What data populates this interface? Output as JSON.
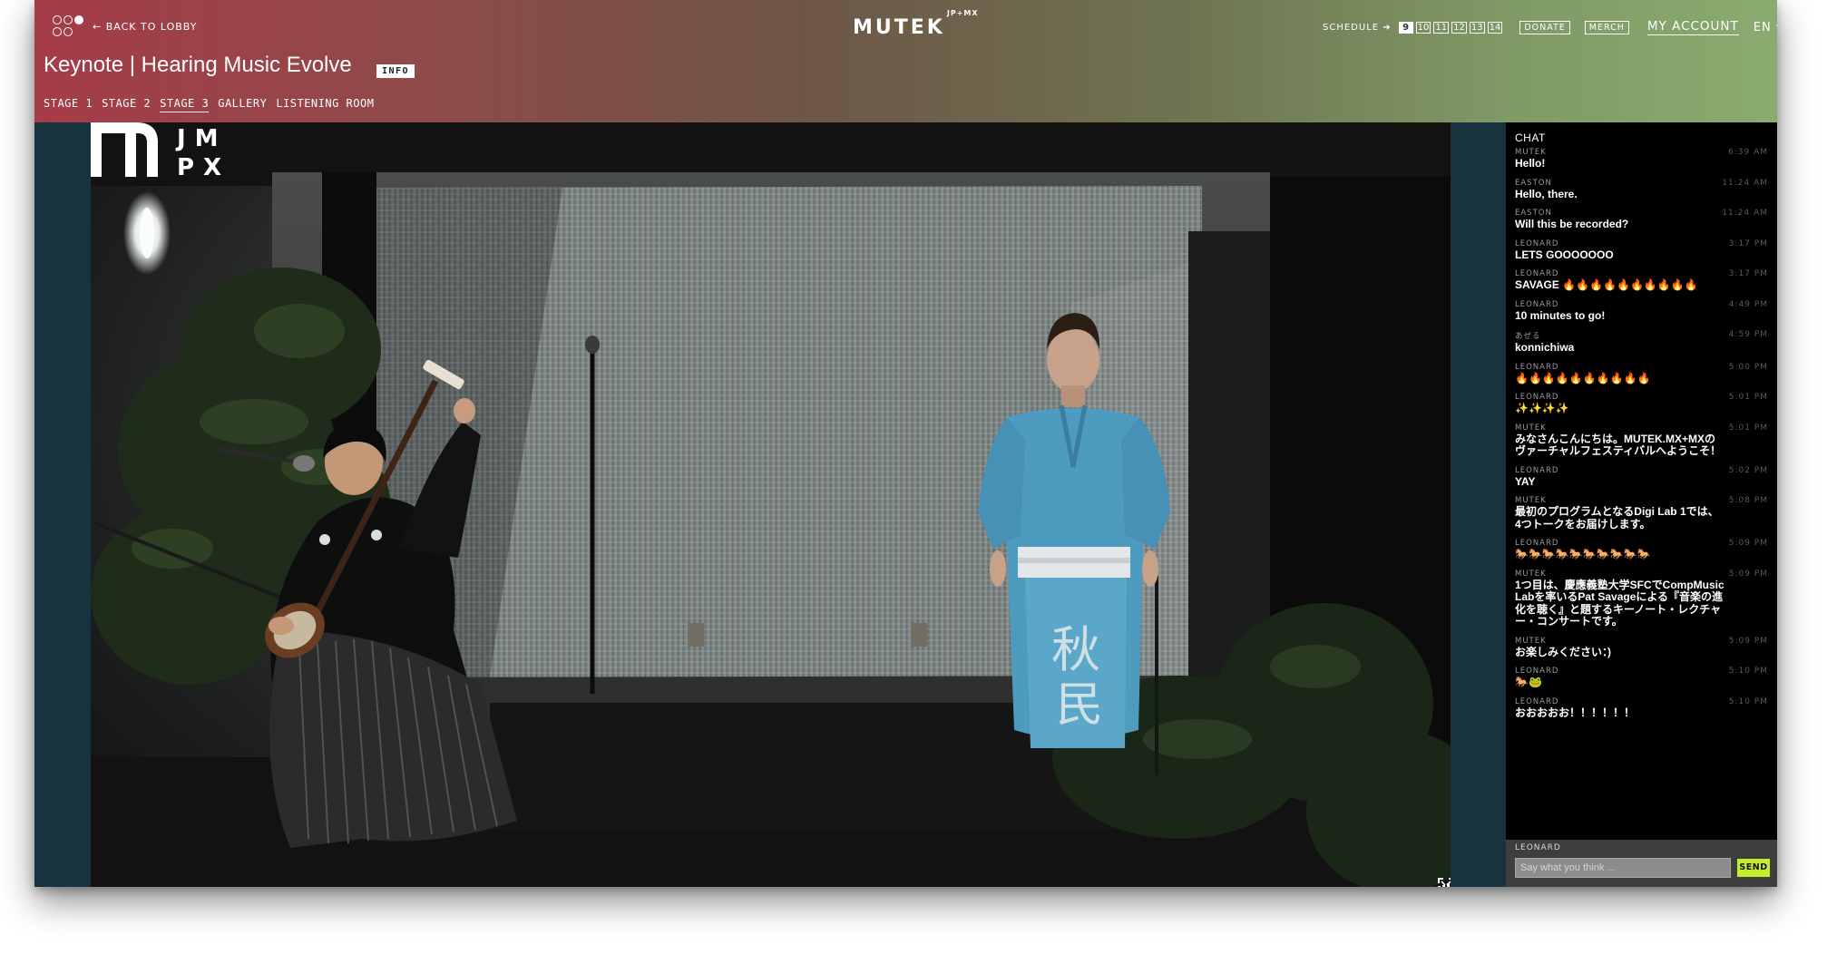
{
  "header": {
    "back_label": "← BACK TO LOBBY",
    "brand": "MUTEK",
    "brand_sup": "JP+MX",
    "schedule_label": "SCHEDULE ➔",
    "schedule_days": [
      "9",
      "10",
      "11",
      "12",
      "13",
      "14"
    ],
    "active_day": "9",
    "donate_label": "DONATE",
    "merch_label": "MERCH",
    "account_label": "MY ACCOUNT",
    "language_label": "EN ▾",
    "title": "Keynote | Hearing Music Evolve",
    "info_label": "INFO",
    "stage_tabs": [
      "STAGE 1",
      "STAGE 2",
      "STAGE 3",
      "GALLERY",
      "LISTENING ROOM"
    ],
    "active_tab": "STAGE 3"
  },
  "video": {
    "overlay_logo_letters": "J M P X",
    "banner_text": "秋 民 会",
    "volume_icon": "volume-bars-icon",
    "fullscreen_icon": "fullscreen-icon"
  },
  "chat": {
    "title": "CHAT",
    "messages": [
      {
        "user": "MUTEK",
        "time": "6:39 AM",
        "text": "Hello!"
      },
      {
        "user": "EASTON",
        "time": "11:24 AM",
        "text": "Hello, there."
      },
      {
        "user": "EASTON",
        "time": "11:24 AM",
        "text": "Will this be recorded?"
      },
      {
        "user": "LEONARD",
        "time": "3:17 PM",
        "text": "LETS GOOOOOOO"
      },
      {
        "user": "LEONARD",
        "time": "3:17 PM",
        "text": "SAVAGE 🔥🔥🔥🔥🔥🔥🔥🔥🔥🔥"
      },
      {
        "user": "LEONARD",
        "time": "4:49 PM",
        "text": "10 minutes to go!"
      },
      {
        "user": "あぜる",
        "time": "4:59 PM",
        "text": "konnichiwa"
      },
      {
        "user": "LEONARD",
        "time": "5:00 PM",
        "text": "🔥🔥🔥🔥🔥🔥🔥🔥🔥🔥"
      },
      {
        "user": "LEONARD",
        "time": "5:01 PM",
        "text": "✨✨✨✨"
      },
      {
        "user": "MUTEK",
        "time": "5:01 PM",
        "text": "みなさんこんにちは。MUTEK.MX+MXのヴァーチャルフェスティバルへようこそ！"
      },
      {
        "user": "LEONARD",
        "time": "5:02 PM",
        "text": "YAY"
      },
      {
        "user": "MUTEK",
        "time": "5:08 PM",
        "text": "最初のプログラムとなるDigi Lab 1では、4つトークをお届けします。"
      },
      {
        "user": "LEONARD",
        "time": "5:09 PM",
        "text": "🐎🐎🐎🐎🐎🐎🐎🐎🐎🐎"
      },
      {
        "user": "MUTEK",
        "time": "5:09 PM",
        "text": "1つ目は、慶應義塾大学SFCでCompMusic Labを率いるPat Savageによる『音楽の進化を聴く』と題するキーノート・レクチャー・コンサートです。"
      },
      {
        "user": "MUTEK",
        "time": "5:09 PM",
        "text": "お楽しみください：)"
      },
      {
        "user": "LEONARD",
        "time": "5:10 PM",
        "text": "🐎🐸"
      },
      {
        "user": "LEONARD",
        "time": "5:10 PM",
        "text": "おおおおお！！！！！！"
      }
    ],
    "current_user": "LEONARD",
    "input_placeholder": "Say what you think ...",
    "send_label": "SEND"
  },
  "colors": {
    "header_left": "#a53c48",
    "header_right": "#8aab6f",
    "send_button": "#c3ee2e",
    "kimono_blue": "#4e9bc0"
  }
}
